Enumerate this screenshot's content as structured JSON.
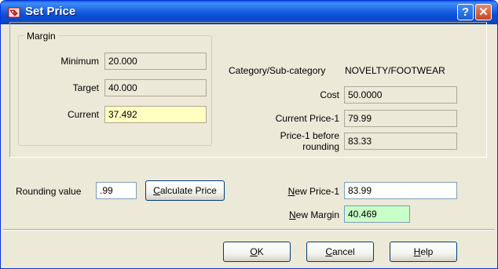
{
  "window": {
    "title": "Set Price"
  },
  "margin": {
    "legend": "Margin",
    "minimum_label": "Minimum",
    "minimum_value": "20.000",
    "target_label": "Target",
    "target_value": "40.000",
    "current_label": "Current",
    "current_value": "37.492"
  },
  "category": {
    "label": "Category/Sub-category",
    "value": "NOVELTY/FOOTWEAR"
  },
  "cost": {
    "label": "Cost",
    "value": "50.0000"
  },
  "current_price": {
    "label": "Current Price-1",
    "value": "79.99"
  },
  "price_before_rounding": {
    "label_line1": "Price-1 before",
    "label_line2": "rounding",
    "value": "83.33"
  },
  "rounding": {
    "label": "Rounding value",
    "value": ".99"
  },
  "calculate_button": {
    "accel": "C",
    "rest": "alculate Price"
  },
  "new_price": {
    "accel": "N",
    "rest": "ew Price-1",
    "value": "83.99"
  },
  "new_margin": {
    "accel": "N",
    "rest": "ew Margin",
    "value": "40.469"
  },
  "ok_button": {
    "accel": "O",
    "rest": "K"
  },
  "cancel_button": {
    "accel": "C",
    "rest": "ancel"
  },
  "help_button": {
    "accel": "H",
    "rest": "elp"
  },
  "colors": {
    "title_bar": "#0a47c4",
    "current_highlight": "#ffffc0",
    "new_margin_highlight": "#c8ffc8"
  },
  "icons": {
    "app": "price-tag-icon",
    "help": "help-icon",
    "close": "close-icon"
  }
}
